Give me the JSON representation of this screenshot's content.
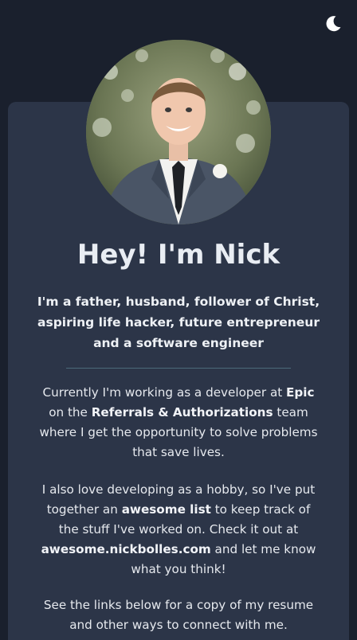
{
  "header": {
    "theme_toggle_icon": "moon-icon"
  },
  "profile": {
    "avatar_icon": "profile-photo",
    "title": "Hey! I'm Nick",
    "tagline": "I'm a father, husband, follower of Christ, aspiring life hacker, future entrepreneur and a software engineer"
  },
  "about": {
    "p1": {
      "t1": "Currently I'm working as a developer at ",
      "b1": "Epic",
      "t2": " on the ",
      "b2": "Referrals & Authorizations",
      "t3": " team where I get the opportunity to solve problems that save lives."
    },
    "p2": {
      "t1": "I also love developing as a hobby, so I've put together an ",
      "b1": "awesome list",
      "t2": " to keep track of the stuff I've worked on. Check it out at ",
      "b2": "awesome.nickbolles.com",
      "t3": " and let me know what you think!"
    },
    "p3": "See the links below for a copy of my resume and other ways to connect with me."
  },
  "colors": {
    "background": "#1a202d",
    "card": "#2c3548",
    "divider": "#4b6a7a",
    "text": "#e7ebf1"
  }
}
